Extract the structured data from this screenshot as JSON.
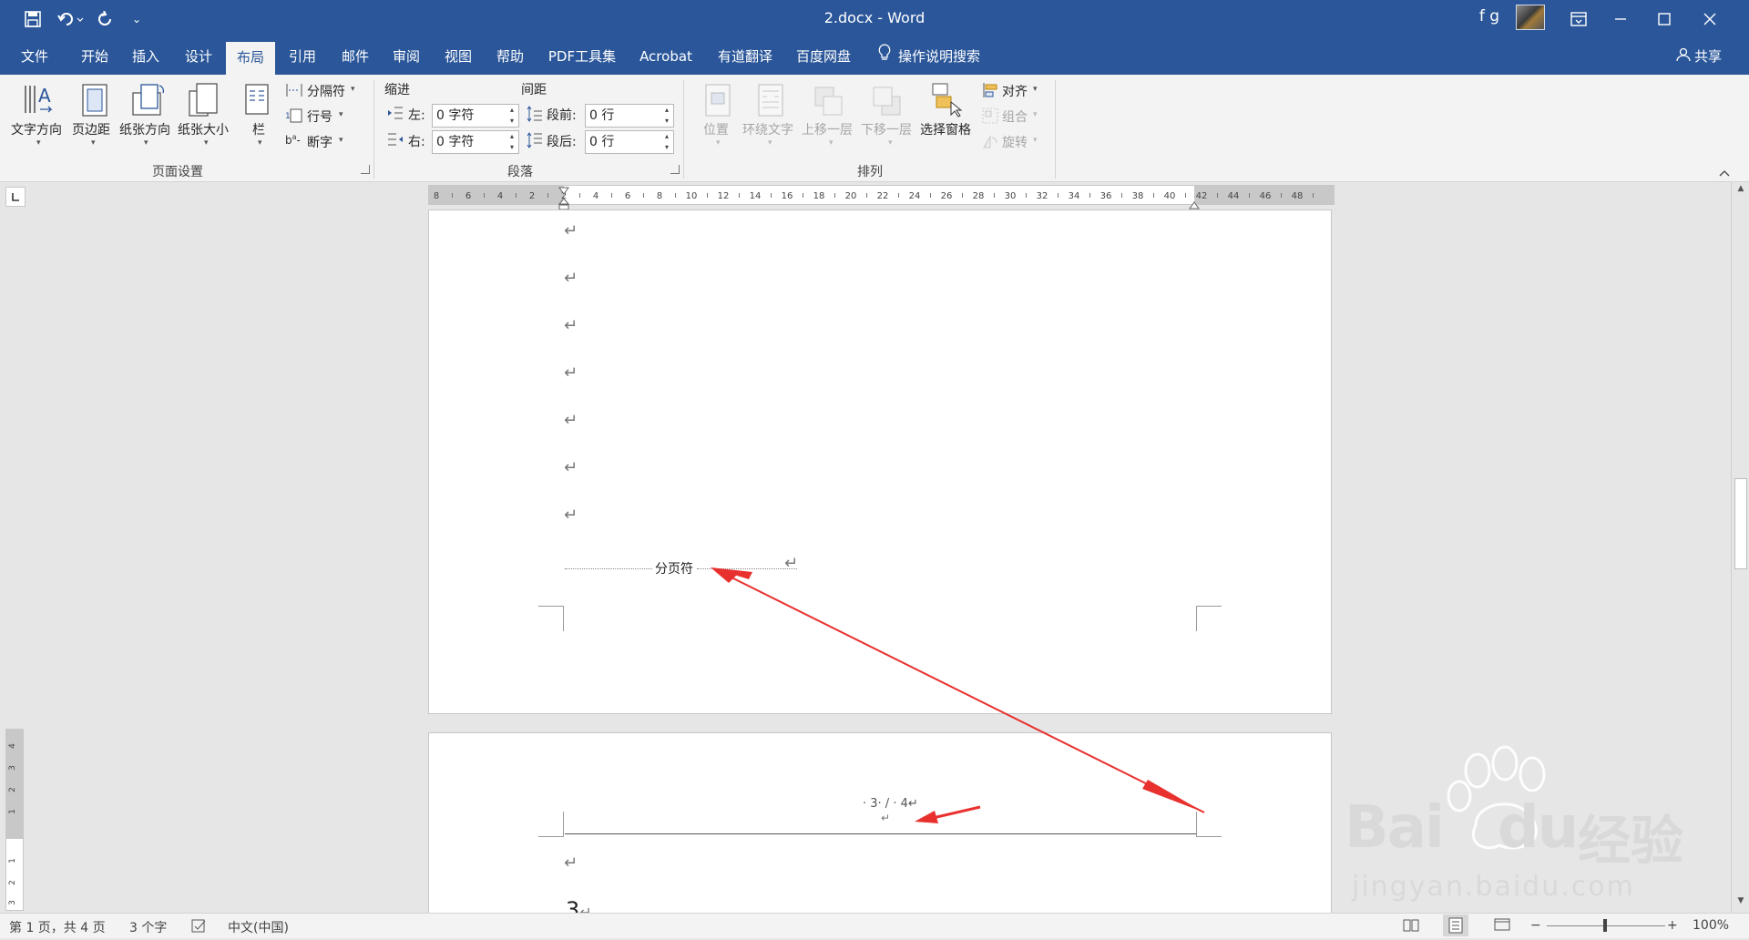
{
  "window": {
    "title": "2.docx  -  Word",
    "user": "f g",
    "share_label": "共享"
  },
  "tabs": [
    "文件",
    "开始",
    "插入",
    "设计",
    "布局",
    "引用",
    "邮件",
    "审阅",
    "视图",
    "帮助",
    "PDF工具集",
    "Acrobat",
    "有道翻译",
    "百度网盘",
    "操作说明搜索"
  ],
  "active_tab": "布局",
  "ribbon": {
    "page_setup": {
      "text_direction": "文字方向",
      "margins": "页边距",
      "orientation": "纸张方向",
      "size": "纸张大小",
      "columns": "栏",
      "breaks": "分隔符",
      "line_numbers": "行号",
      "hyphenation": "断字",
      "group_label": "页面设置"
    },
    "paragraph": {
      "indent_label": "缩进",
      "spacing_label": "间距",
      "left_label": "左:",
      "right_label": "右:",
      "before_label": "段前:",
      "after_label": "段后:",
      "left_value": "0 字符",
      "right_value": "0 字符",
      "before_value": "0 行",
      "after_value": "0 行",
      "group_label": "段落"
    },
    "arrange": {
      "position": "位置",
      "wrap_text": "环绕文字",
      "bring_forward": "上移一层",
      "send_backward": "下移一层",
      "selection_pane": "选择窗格",
      "align": "对齐",
      "group": "组合",
      "rotate": "旋转",
      "group_label": "排列"
    }
  },
  "ruler_labels": [
    "8",
    "6",
    "4",
    "2",
    "2",
    "4",
    "6",
    "8",
    "10",
    "12",
    "14",
    "16",
    "18",
    "20",
    "22",
    "24",
    "26",
    "28",
    "30",
    "32",
    "34",
    "36",
    "38",
    "40",
    "42",
    "44",
    "46",
    "48"
  ],
  "document": {
    "page_break_label": "分页符",
    "header_text": "· 3· / · 4↵",
    "body_heading": "3",
    "paragraph_mark": "↵"
  },
  "status": {
    "page": "第 1 页，共 4 页",
    "words": "3 个字",
    "language": "中文(中国)",
    "zoom": "100%"
  },
  "watermark": {
    "brand": "Bai",
    "brand2": "du",
    "cn": "经验",
    "url": "jingyan.baidu.com"
  },
  "colors": {
    "accent": "#2b579a",
    "annotation_arrow": "#e8312f"
  }
}
